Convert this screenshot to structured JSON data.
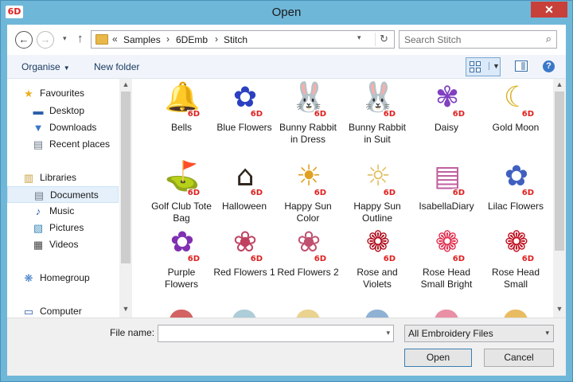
{
  "window": {
    "title": "Open",
    "app_badge": "6D",
    "close_glyph": "✕"
  },
  "nav": {
    "back_glyph": "←",
    "forward_glyph": "→",
    "history_glyph": "▾",
    "up_glyph": "↑",
    "breadcrumb_overflow": "«",
    "crumbs": [
      "Samples",
      "6DEmb",
      "Stitch"
    ],
    "crumb_sep": "›",
    "dropdown_glyph": "▾",
    "refresh_glyph": "↻"
  },
  "search": {
    "placeholder": "Search Stitch",
    "icon_glyph": "⌕"
  },
  "commands": {
    "organise": "Organise",
    "new_folder": "New folder",
    "caret": "▼",
    "help_glyph": "?"
  },
  "sidebar": {
    "items": [
      {
        "label": "Favourites",
        "icon": "star-icon",
        "glyph": "★",
        "color": "#e8b020"
      },
      {
        "label": "Desktop",
        "icon": "desktop-icon",
        "glyph": "▬",
        "color": "#2a5fa8"
      },
      {
        "label": "Downloads",
        "icon": "downloads-icon",
        "glyph": "▼",
        "color": "#3a78c8"
      },
      {
        "label": "Recent places",
        "icon": "recent-places-icon",
        "glyph": "▤",
        "color": "#6d7a88"
      },
      {
        "label": "Libraries",
        "icon": "libraries-icon",
        "glyph": "▥",
        "color": "#c8a040"
      },
      {
        "label": "Documents",
        "icon": "documents-icon",
        "glyph": "▤",
        "color": "#6d7a88",
        "selected": true
      },
      {
        "label": "Music",
        "icon": "music-icon",
        "glyph": "♪",
        "color": "#2a5fa8"
      },
      {
        "label": "Pictures",
        "icon": "pictures-icon",
        "glyph": "▧",
        "color": "#3a8ab8"
      },
      {
        "label": "Videos",
        "icon": "videos-icon",
        "glyph": "▦",
        "color": "#444"
      },
      {
        "label": "Homegroup",
        "icon": "homegroup-icon",
        "glyph": "❋",
        "color": "#3a78c8"
      },
      {
        "label": "Computer",
        "icon": "computer-icon",
        "glyph": "▭",
        "color": "#2a5fa8"
      }
    ]
  },
  "files": [
    {
      "name": "Bells",
      "icon": "bells-thumbnail",
      "glyph": "🔔",
      "color": "#b03040"
    },
    {
      "name": "Blue Flowers",
      "icon": "blue-flowers-thumbnail",
      "glyph": "✿",
      "color": "#2a40c0"
    },
    {
      "name": "Bunny Rabbit in Dress",
      "icon": "bunny-dress-thumbnail",
      "glyph": "🐰",
      "color": "#d070a0"
    },
    {
      "name": "Bunny Rabbit in Suit",
      "icon": "bunny-suit-thumbnail",
      "glyph": "🐰",
      "color": "#2060c0"
    },
    {
      "name": "Daisy",
      "icon": "daisy-thumbnail",
      "glyph": "✾",
      "color": "#8040c0"
    },
    {
      "name": "Gold Moon",
      "icon": "gold-moon-thumbnail",
      "glyph": "☾",
      "color": "#d8b020"
    },
    {
      "name": "Golf Club Tote Bag",
      "icon": "golf-bag-thumbnail",
      "glyph": "⛳",
      "color": "#a08040"
    },
    {
      "name": "Halloween",
      "icon": "halloween-thumbnail",
      "glyph": "⌂",
      "color": "#302820"
    },
    {
      "name": "Happy Sun Color",
      "icon": "happy-sun-color-thumbnail",
      "glyph": "☀",
      "color": "#e0a020"
    },
    {
      "name": "Happy Sun Outline",
      "icon": "happy-sun-outline-thumbnail",
      "glyph": "☼",
      "color": "#e0c060"
    },
    {
      "name": "IsabellaDiary",
      "icon": "diary-thumbnail",
      "glyph": "▤",
      "color": "#c060a0"
    },
    {
      "name": "Lilac Flowers",
      "icon": "lilac-flowers-thumbnail",
      "glyph": "✿",
      "color": "#4060c0"
    },
    {
      "name": "Purple Flowers",
      "icon": "purple-flowers-thumbnail",
      "glyph": "✿",
      "color": "#8030b0"
    },
    {
      "name": "Red Flowers 1",
      "icon": "red-flowers-1-thumbnail",
      "glyph": "❀",
      "color": "#c04060"
    },
    {
      "name": "Red Flowers 2",
      "icon": "red-flowers-2-thumbnail",
      "glyph": "❀",
      "color": "#c05070"
    },
    {
      "name": "Rose and Violets",
      "icon": "rose-violets-thumbnail",
      "glyph": "❁",
      "color": "#b01020"
    },
    {
      "name": "Rose Head Small Bright",
      "icon": "rose-bright-thumbnail",
      "glyph": "❁",
      "color": "#e03050"
    },
    {
      "name": "Rose Head Small",
      "icon": "rose-small-thumbnail",
      "glyph": "❁",
      "color": "#c01020"
    }
  ],
  "partial_row": [
    "#c02020",
    "#8ab8c8",
    "#e0c060",
    "#6090c0",
    "#e06080",
    "#e0a020"
  ],
  "footer": {
    "file_name_label": "File name:",
    "file_name_value": "",
    "filter_value": "All Embroidery Files",
    "open_label": "Open",
    "cancel_label": "Cancel",
    "dd_glyph": "▾"
  },
  "badge_text": "6D",
  "scroll": {
    "up": "▲",
    "down": "▼"
  }
}
